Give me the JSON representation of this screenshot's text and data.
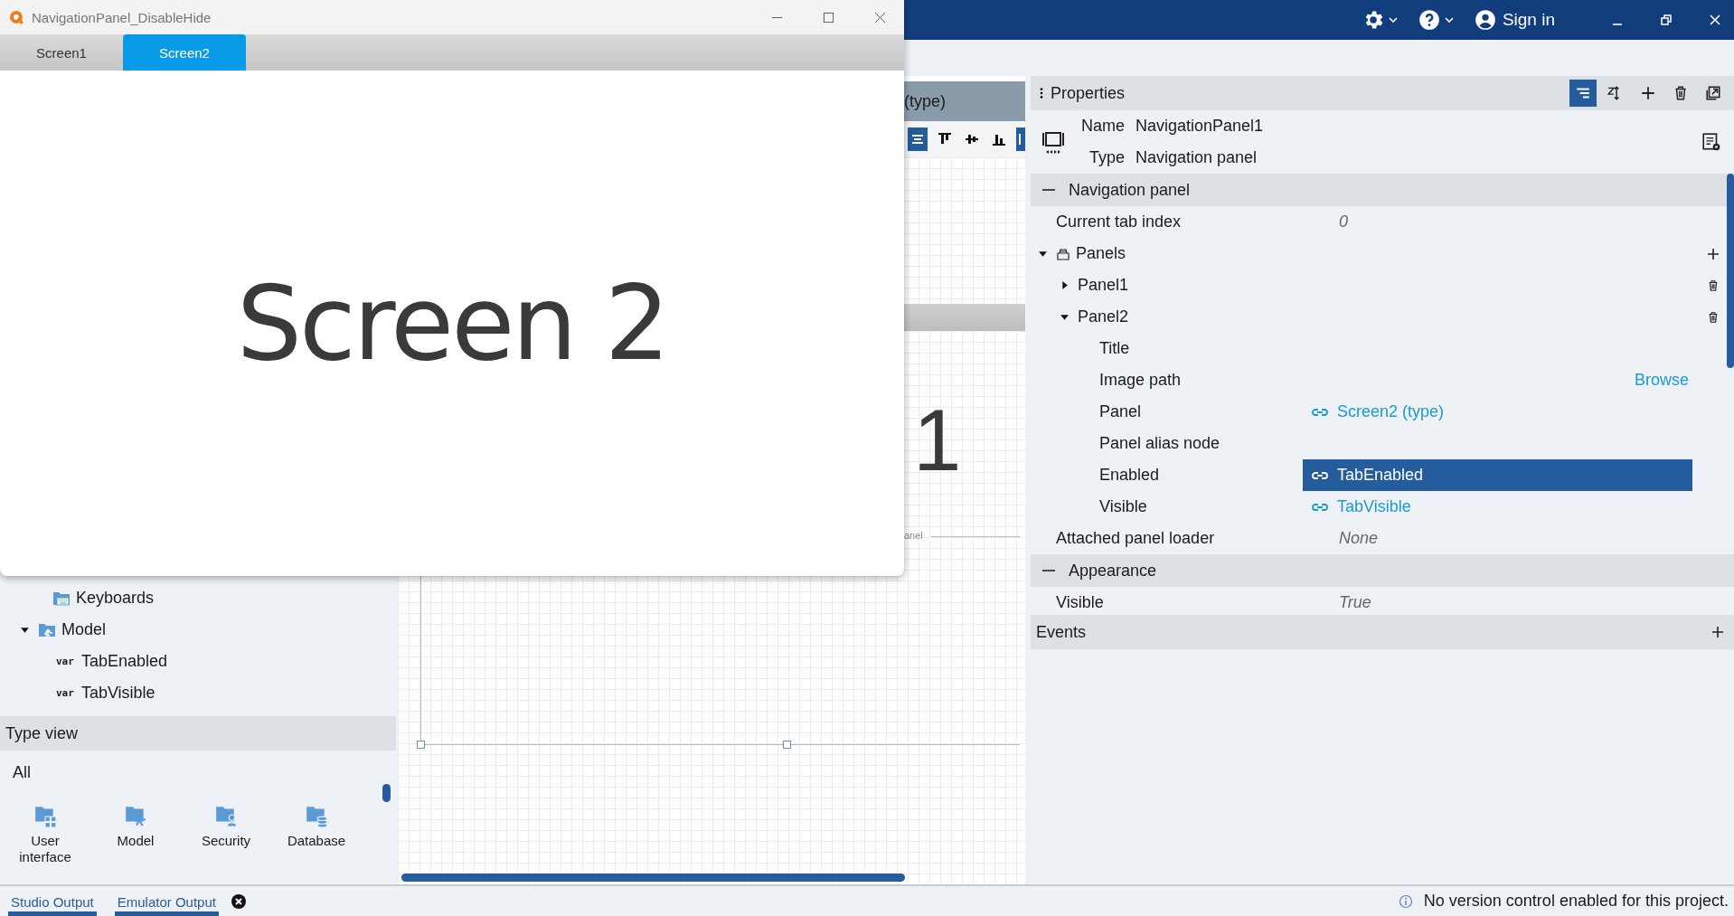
{
  "emulator": {
    "title": "NavigationPanel_DisableHide",
    "tabs": [
      {
        "label": "Screen1",
        "selected": false
      },
      {
        "label": "Screen2",
        "selected": true
      }
    ],
    "content": "Screen 2"
  },
  "top_bar": {
    "sign_in": "Sign in"
  },
  "project_tree": [
    {
      "label": "Keyboards",
      "kind": "keyboards"
    },
    {
      "label": "Model",
      "kind": "model",
      "expanded": true,
      "children": [
        {
          "label": "TabEnabled",
          "kind": "variable",
          "tag": "var"
        },
        {
          "label": "TabVisible",
          "kind": "variable",
          "tag": "var"
        }
      ]
    }
  ],
  "type_view": {
    "title": "Type view",
    "filter": "All",
    "items": [
      {
        "label": "User interface",
        "kind": "ui"
      },
      {
        "label": "Model",
        "kind": "model"
      },
      {
        "label": "Security",
        "kind": "security"
      },
      {
        "label": "Database",
        "kind": "database"
      }
    ]
  },
  "canvas": {
    "header": "(type)",
    "big_label": "1",
    "panel_label": "anel"
  },
  "properties": {
    "title": "Properties",
    "name_label": "Name",
    "name": "NavigationPanel1",
    "type_label": "Type",
    "type": "Navigation panel",
    "sections": [
      {
        "title": "Navigation panel",
        "expanded": true,
        "rows": [
          {
            "kind": "value",
            "label": "Current tab index",
            "value": "0"
          },
          {
            "kind": "group",
            "label": "Panels",
            "expanded": true,
            "children": [
              {
                "kind": "item",
                "label": "Panel1",
                "expanded": false
              },
              {
                "kind": "item",
                "label": "Panel2",
                "expanded": true,
                "children": [
                  {
                    "kind": "empty",
                    "label": "Title"
                  },
                  {
                    "kind": "action",
                    "label": "Image path",
                    "action": "Browse"
                  },
                  {
                    "kind": "link",
                    "label": "Panel",
                    "value": "Screen2 (type)",
                    "selected": false
                  },
                  {
                    "kind": "empty",
                    "label": "Panel alias node"
                  },
                  {
                    "kind": "link",
                    "label": "Enabled",
                    "value": "TabEnabled",
                    "selected": true
                  },
                  {
                    "kind": "link",
                    "label": "Visible",
                    "value": "TabVisible",
                    "selected": false
                  }
                ]
              }
            ]
          },
          {
            "kind": "value",
            "label": "Attached panel loader",
            "value": "None"
          }
        ]
      },
      {
        "title": "Appearance",
        "expanded": true,
        "rows": [
          {
            "kind": "value",
            "label": "Visible",
            "value": "True"
          }
        ]
      }
    ],
    "events": "Events"
  },
  "output_tabs": [
    {
      "label": "Studio Output",
      "closable": false
    },
    {
      "label": "Emulator Output",
      "closable": true
    }
  ],
  "status": "No version control enabled for this project."
}
